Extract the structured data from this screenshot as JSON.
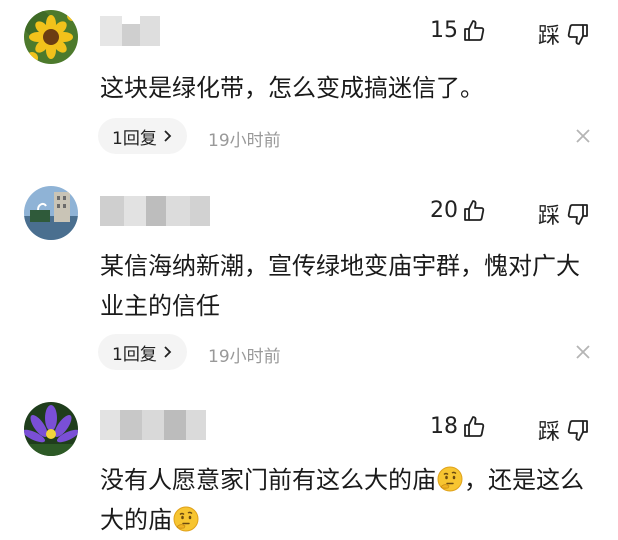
{
  "comments": [
    {
      "likes": "15",
      "dislike_label": "踩",
      "text": "这块是绿化带，怎么变成搞迷信了。",
      "reply_label": "1回复",
      "time": "19小时前"
    },
    {
      "likes": "20",
      "dislike_label": "踩",
      "text": "某信海纳新潮，宣传绿地变庙宇群，愧对广大业主的信任",
      "reply_label": "1回复",
      "time": "19小时前"
    },
    {
      "likes": "18",
      "dislike_label": "踩",
      "text_part1": "没有人愿意家门前有这么大的庙",
      "text_part2": "，还是这么大的庙"
    }
  ],
  "icons": {
    "like": "thumbs-up-icon",
    "dislike": "thumbs-down-icon",
    "reply_chevron": "chevron-right-icon",
    "close": "close-icon",
    "thinking_emoji": "thinking-face-emoji"
  },
  "colors": {
    "text": "#1a1a1a",
    "muted": "#999999",
    "pill_bg": "#f4f4f4",
    "blur": "#d9d9d9"
  }
}
